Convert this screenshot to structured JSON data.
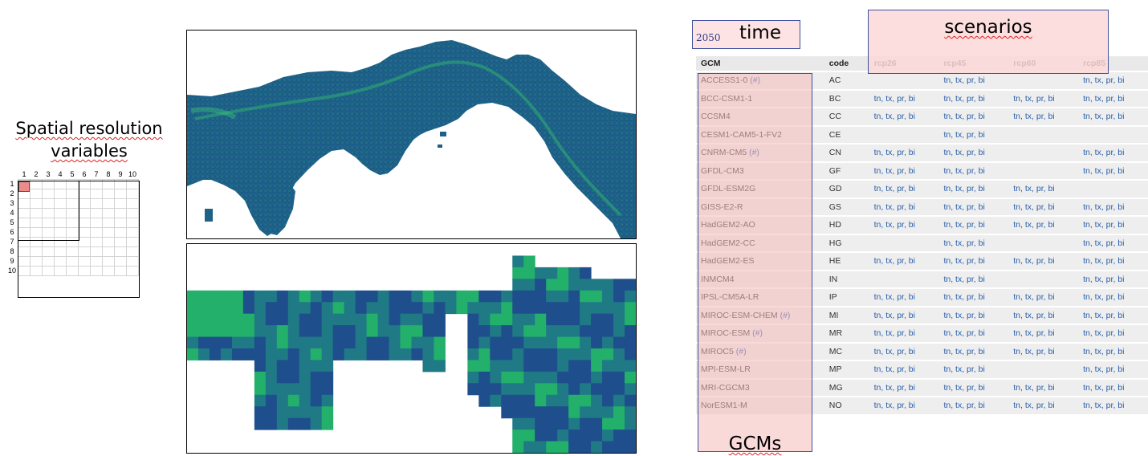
{
  "spatial": {
    "title_line1": "Spatial resolution",
    "title_line2": "variables",
    "col_labels": [
      "1",
      "2",
      "3",
      "4",
      "5",
      "6",
      "7",
      "8",
      "9",
      "10"
    ],
    "row_labels": [
      "1",
      "2",
      "3",
      "4",
      "5",
      "6",
      "7",
      "8",
      "9",
      "10"
    ],
    "highlight_color": "#ef8a8a"
  },
  "labels": {
    "time_year": "2050",
    "time": "time",
    "scenarios": "scenarios",
    "gcms": "GCMs"
  },
  "table": {
    "headers": [
      "GCM",
      "code",
      "rcp26",
      "rcp45",
      "rcp60",
      "rcp85"
    ],
    "rows": [
      {
        "gcm": "ACCESS1-0",
        "hash": "(#)",
        "code": "AC",
        "rcp26": "",
        "rcp45": "tn, tx, pr, bi",
        "rcp60": "",
        "rcp85": "tn, tx, pr, bi"
      },
      {
        "gcm": "BCC-CSM1-1",
        "hash": "",
        "code": "BC",
        "rcp26": "tn, tx, pr, bi",
        "rcp45": "tn, tx, pr, bi",
        "rcp60": "tn, tx, pr, bi",
        "rcp85": "tn, tx, pr, bi"
      },
      {
        "gcm": "CCSM4",
        "hash": "",
        "code": "CC",
        "rcp26": "tn, tx, pr, bi",
        "rcp45": "tn, tx, pr, bi",
        "rcp60": "tn, tx, pr, bi",
        "rcp85": "tn, tx, pr, bi"
      },
      {
        "gcm": "CESM1-CAM5-1-FV2",
        "hash": "",
        "code": "CE",
        "rcp26": "",
        "rcp45": "tn, tx, pr, bi",
        "rcp60": "",
        "rcp85": ""
      },
      {
        "gcm": "CNRM-CM5",
        "hash": "(#)",
        "code": "CN",
        "rcp26": "tn, tx, pr, bi",
        "rcp45": "tn, tx, pr, bi",
        "rcp60": "",
        "rcp85": "tn, tx, pr, bi"
      },
      {
        "gcm": "GFDL-CM3",
        "hash": "",
        "code": "GF",
        "rcp26": "tn, tx, pr, bi",
        "rcp45": "tn, tx, pr, bi",
        "rcp60": "",
        "rcp85": "tn, tx, pr, bi"
      },
      {
        "gcm": "GFDL-ESM2G",
        "hash": "",
        "code": "GD",
        "rcp26": "tn, tx, pr, bi",
        "rcp45": "tn, tx, pr, bi",
        "rcp60": "tn, tx, pr, bi",
        "rcp85": ""
      },
      {
        "gcm": "GISS-E2-R",
        "hash": "",
        "code": "GS",
        "rcp26": "tn, tx, pr, bi",
        "rcp45": "tn, tx, pr, bi",
        "rcp60": "tn, tx, pr, bi",
        "rcp85": "tn, tx, pr, bi"
      },
      {
        "gcm": "HadGEM2-AO",
        "hash": "",
        "code": "HD",
        "rcp26": "tn, tx, pr, bi",
        "rcp45": "tn, tx, pr, bi",
        "rcp60": "tn, tx, pr, bi",
        "rcp85": "tn, tx, pr, bi"
      },
      {
        "gcm": "HadGEM2-CC",
        "hash": "",
        "code": "HG",
        "rcp26": "",
        "rcp45": "tn, tx, pr, bi",
        "rcp60": "",
        "rcp85": "tn, tx, pr, bi"
      },
      {
        "gcm": "HadGEM2-ES",
        "hash": "",
        "code": "HE",
        "rcp26": "tn, tx, pr, bi",
        "rcp45": "tn, tx, pr, bi",
        "rcp60": "tn, tx, pr, bi",
        "rcp85": "tn, tx, pr, bi"
      },
      {
        "gcm": "INMCM4",
        "hash": "",
        "code": "IN",
        "rcp26": "",
        "rcp45": "tn, tx, pr, bi",
        "rcp60": "",
        "rcp85": "tn, tx, pr, bi"
      },
      {
        "gcm": "IPSL-CM5A-LR",
        "hash": "",
        "code": "IP",
        "rcp26": "tn, tx, pr, bi",
        "rcp45": "tn, tx, pr, bi",
        "rcp60": "tn, tx, pr, bi",
        "rcp85": "tn, tx, pr, bi"
      },
      {
        "gcm": "MIROC-ESM-CHEM",
        "hash": "(#)",
        "code": "MI",
        "rcp26": "tn, tx, pr, bi",
        "rcp45": "tn, tx, pr, bi",
        "rcp60": "tn, tx, pr, bi",
        "rcp85": "tn, tx, pr, bi"
      },
      {
        "gcm": "MIROC-ESM",
        "hash": "(#)",
        "code": "MR",
        "rcp26": "tn, tx, pr, bi",
        "rcp45": "tn, tx, pr, bi",
        "rcp60": "tn, tx, pr, bi",
        "rcp85": "tn, tx, pr, bi"
      },
      {
        "gcm": "MIROC5",
        "hash": "(#)",
        "code": "MC",
        "rcp26": "tn, tx, pr, bi",
        "rcp45": "tn, tx, pr, bi",
        "rcp60": "tn, tx, pr, bi",
        "rcp85": "tn, tx, pr, bi"
      },
      {
        "gcm": "MPI-ESM-LR",
        "hash": "",
        "code": "MP",
        "rcp26": "tn, tx, pr, bi",
        "rcp45": "tn, tx, pr, bi",
        "rcp60": "",
        "rcp85": "tn, tx, pr, bi"
      },
      {
        "gcm": "MRI-CGCM3",
        "hash": "",
        "code": "MG",
        "rcp26": "tn, tx, pr, bi",
        "rcp45": "tn, tx, pr, bi",
        "rcp60": "tn, tx, pr, bi",
        "rcp85": "tn, tx, pr, bi"
      },
      {
        "gcm": "NorESM1-M",
        "hash": "",
        "code": "NO",
        "rcp26": "tn, tx, pr, bi",
        "rcp45": "tn, tx, pr, bi",
        "rcp60": "tn, tx, pr, bi",
        "rcp85": "tn, tx, pr, bi"
      }
    ]
  },
  "colors": {
    "map_low": "#1f4e8c",
    "map_mid": "#1f7a86",
    "map_high": "#22b06a",
    "label_fill": "#fde3e3",
    "label_border": "#3f4f9f",
    "link": "#2a5fa8"
  }
}
